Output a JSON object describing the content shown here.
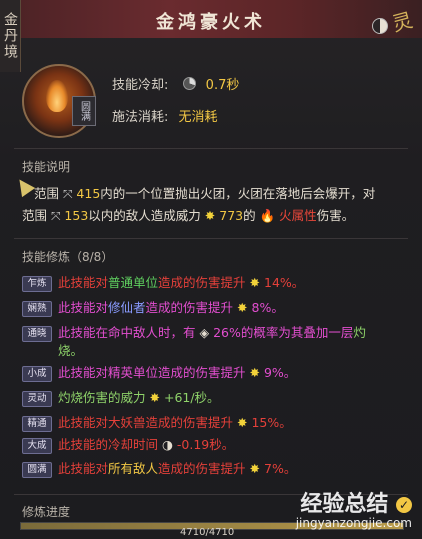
{
  "realm": "金丹境",
  "title": "金鸿豪火术",
  "top_glyph": "灵",
  "skill": {
    "level_tag": "圆满",
    "cooldown_label": "技能冷却:",
    "cooldown_value": "0.7秒",
    "cost_label": "施法消耗:",
    "cost_value": "无消耗"
  },
  "description": {
    "header": "技能说明",
    "parts": {
      "p1": "范围",
      "p2": "415",
      "p3": "内的一个位置抛出火团，火团在落地后会爆开，对",
      "p4": "范围",
      "p5": "153",
      "p6": "以内的敌人造成威力",
      "p7": "773",
      "p8": "的",
      "p9": "火属性",
      "p10": "伤害。"
    }
  },
  "training": {
    "header": "技能修炼（8/8）",
    "rows": [
      {
        "tag": "乍炼",
        "a": "此技能对",
        "b": "普通单位",
        "c": "造成的伤害提升",
        "d": "14%。"
      },
      {
        "tag": "娴熟",
        "a": "此技能对",
        "b": "修仙者",
        "c": "造成的伤害提升",
        "d": "8%。"
      },
      {
        "tag": "通晓",
        "a": "此技能在命中敌人时，有",
        "b": "26%的概率为其叠加一层",
        "c": "灼",
        "d": "烧。"
      },
      {
        "tag": "小成",
        "a": "此技能对精英单位造成的伤害提升",
        "d": "9%。"
      },
      {
        "tag": "灵动",
        "a": "灼烧伤害的威力",
        "d": "+61/秒。"
      },
      {
        "tag": "精通",
        "a": "此技能对大妖兽造成的伤害提升",
        "d": "15%。"
      },
      {
        "tag": "大成",
        "a": "此技能的冷却时间",
        "d": "-0.19秒。"
      },
      {
        "tag": "圆满",
        "a": "此技能对",
        "b": "所有敌人",
        "c": "造成的伤害提升",
        "d": "7%。"
      }
    ]
  },
  "progress": {
    "label": "修炼进度",
    "value": "4710/4710",
    "fraction": 1.0
  },
  "watermark": {
    "name": "经验总结",
    "url": "jingyanzongjie.com"
  }
}
